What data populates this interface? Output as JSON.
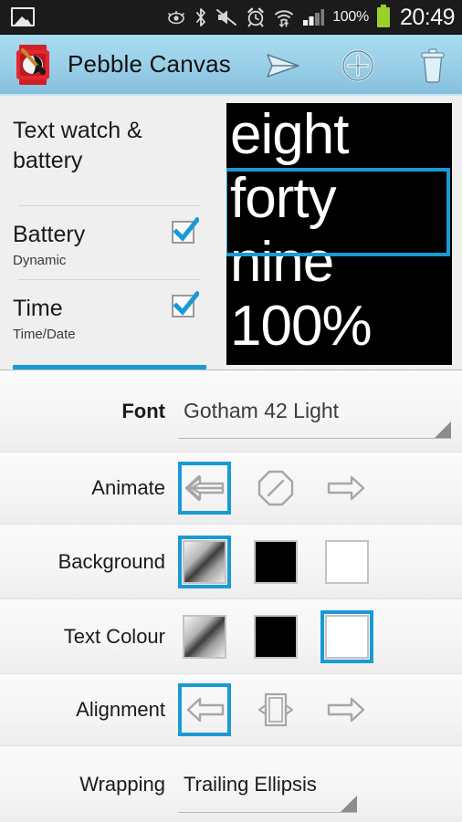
{
  "statusbar": {
    "icons": [
      "gallery-icon",
      "smart-stay-eye-icon",
      "bluetooth-icon",
      "mute-icon",
      "alarm-clock-icon",
      "wifi-icon",
      "signal-bars-icon"
    ],
    "battery_percent": "100%",
    "time": "20:49"
  },
  "actionbar": {
    "app_icon": "pebble-watch-brush-icon",
    "title": "Pebble Canvas",
    "actions": [
      {
        "name": "send-button",
        "icon": "send-paper-plane-icon"
      },
      {
        "name": "add-button",
        "icon": "plus-circle-icon"
      },
      {
        "name": "delete-button",
        "icon": "trash-can-icon"
      }
    ]
  },
  "list": {
    "header": "Text watch & battery",
    "items": [
      {
        "title": "Battery",
        "subtitle": "Dynamic",
        "checked": true
      },
      {
        "title": "Time",
        "subtitle": "Time/Date",
        "checked": true
      }
    ]
  },
  "preview": {
    "lines": [
      "eight",
      "forty",
      "nine",
      "100%"
    ],
    "selected_line_index": 1,
    "background_color": "#000000",
    "text_color": "#ffffff",
    "selection_color": "#1a9ad4"
  },
  "settings": {
    "accent_color": "#1a9ad4",
    "rows": [
      {
        "name": "font",
        "label": "Font",
        "type": "spinner",
        "value": "Gotham 42 Light"
      },
      {
        "name": "animate",
        "label": "Animate",
        "type": "options",
        "options": [
          {
            "name": "animate-left",
            "icon": "arrow-left-icon",
            "selected": true
          },
          {
            "name": "animate-none",
            "icon": "no-entry-octagon-icon",
            "selected": false
          },
          {
            "name": "animate-right",
            "icon": "arrow-right-icon",
            "selected": false
          }
        ]
      },
      {
        "name": "background",
        "label": "Background",
        "type": "swatches",
        "options": [
          {
            "name": "background-gradient",
            "swatch": "gradient",
            "selected": true
          },
          {
            "name": "background-black",
            "swatch": "black",
            "selected": false
          },
          {
            "name": "background-white",
            "swatch": "white",
            "selected": false
          }
        ]
      },
      {
        "name": "text-colour",
        "label": "Text Colour",
        "type": "swatches",
        "options": [
          {
            "name": "text-colour-gradient",
            "swatch": "gradient",
            "selected": false
          },
          {
            "name": "text-colour-black",
            "swatch": "black",
            "selected": false
          },
          {
            "name": "text-colour-white",
            "swatch": "white",
            "selected": true
          }
        ]
      },
      {
        "name": "alignment",
        "label": "Alignment",
        "type": "options",
        "options": [
          {
            "name": "align-left",
            "icon": "arrow-left-icon",
            "selected": true
          },
          {
            "name": "align-center",
            "icon": "align-center-icon",
            "selected": false
          },
          {
            "name": "align-right",
            "icon": "arrow-right-icon",
            "selected": false
          }
        ]
      },
      {
        "name": "wrapping",
        "label": "Wrapping",
        "type": "spinner",
        "value": "Trailing Ellipsis"
      }
    ]
  }
}
